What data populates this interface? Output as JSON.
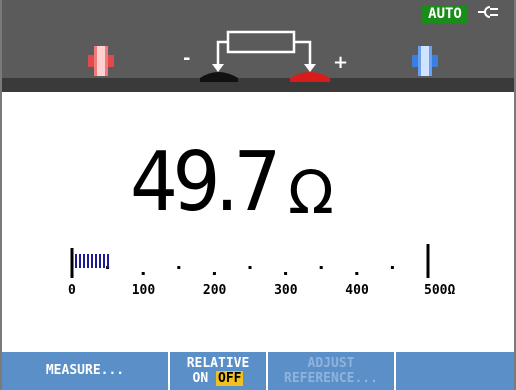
{
  "status": {
    "range_mode": "AUTO",
    "power_icon": "plug-icon"
  },
  "probes": {
    "minus_sign": "-",
    "plus_sign": "+"
  },
  "reading": {
    "value": "49.7",
    "unit": "Ω"
  },
  "bar_graph": {
    "tick_labels": [
      "0",
      "100",
      "200",
      "300",
      "400",
      "500Ω"
    ],
    "fill_fraction": 0.0994
  },
  "softkeys": {
    "measure": "MEASURE...",
    "relative_line1": "RELATIVE",
    "relative_on": "ON",
    "relative_off": "OFF",
    "adjust_line1": "ADJUST",
    "adjust_line2": "REFERENCE..."
  },
  "colors": {
    "accent_red": "#e23030",
    "accent_blue": "#3a7ee0",
    "auto_badge": "#1a8c1a",
    "softkey_bg": "#5a8fc8",
    "highlight": "#f0c020"
  }
}
